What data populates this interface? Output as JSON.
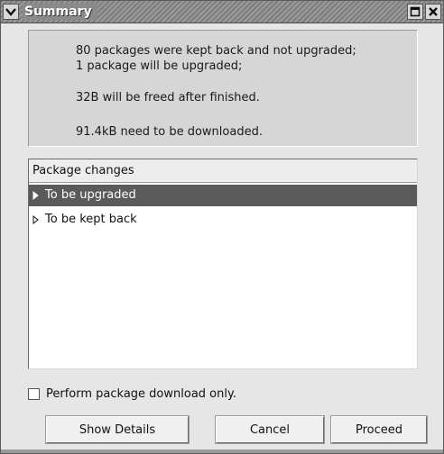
{
  "window": {
    "title": "Summary"
  },
  "summary": {
    "line1": "80 packages were kept back and not upgraded;",
    "line2": "1 package will be upgraded;",
    "line3": "32B will be freed after finished.",
    "line4": "91.4kB need to be downloaded."
  },
  "package_changes": {
    "header": "Package changes",
    "rows": [
      {
        "label": "To be upgraded",
        "selected": true
      },
      {
        "label": "To be kept back",
        "selected": false
      }
    ]
  },
  "options": {
    "download_only_label": "Perform package download only.",
    "download_only_checked": false
  },
  "buttons": {
    "show_details": "Show Details",
    "cancel": "Cancel",
    "proceed": "Proceed"
  },
  "icons": {
    "window_menu": "chevron-down-icon",
    "maximize": "maximize-icon",
    "close": "close-icon",
    "expander": "triangle-right-icon"
  }
}
